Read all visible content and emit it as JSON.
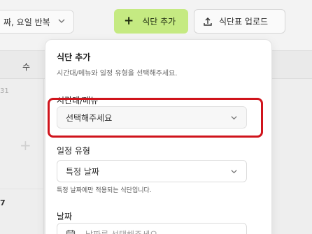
{
  "toolbar": {
    "filter_value": "짜, 요일 반복",
    "add_label": "식단 추가",
    "add_icon": "plus-icon",
    "upload_label": "식단표 업로드",
    "upload_icon": "upload-icon",
    "add_color": "#c5ea82"
  },
  "calendar": {
    "day_label": "수",
    "date_a": "31",
    "date_b": "7"
  },
  "popover": {
    "title": "식단 추가",
    "subtitle": "시간대/메뉴와 일정 유형을 선택해주세요.",
    "meal_label": "시간대/메뉴",
    "meal_value": "선택해주세요",
    "schedule_label": "일정 유형",
    "schedule_value": "특정 날짜",
    "schedule_hint": "특정 날짜에만 적용되는 식단입니다.",
    "date_label": "날짜",
    "date_placeholder": "날짜를 선택해주세요"
  },
  "highlight_color": "#d0141c"
}
